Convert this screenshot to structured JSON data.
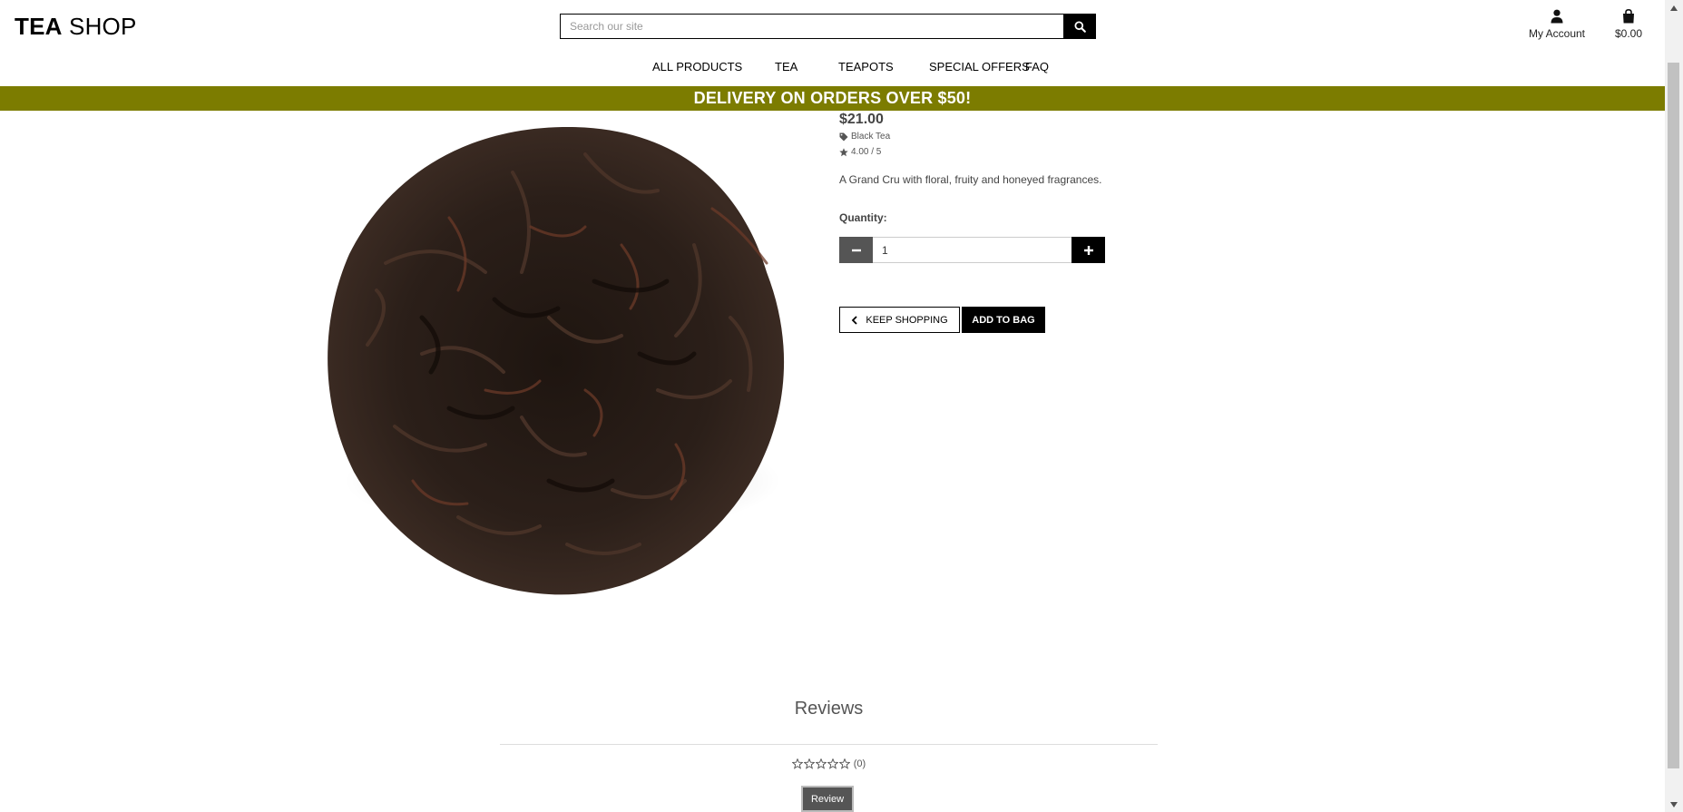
{
  "header": {
    "logo_bold": "TEA",
    "logo_light": " SHOP",
    "search_placeholder": "Search our site",
    "account_label": "My Account",
    "bag_total": "$0.00"
  },
  "nav": {
    "items": [
      "ALL PRODUCTS",
      "TEA",
      "TEAPOTS",
      "SPECIAL OFFERS",
      "FAQ"
    ]
  },
  "banner": {
    "text": "DELIVERY ON ORDERS OVER $50!"
  },
  "product": {
    "price": "$21.00",
    "category": "Black Tea",
    "rating": "4.00 / 5",
    "description": "A Grand Cru with floral, fruity and honeyed fragrances.",
    "quantity_label": "Quantity:",
    "quantity_value": "1",
    "keep_shopping_label": "KEEP SHOPPING",
    "add_to_bag_label": "ADD TO BAG"
  },
  "reviews": {
    "title": "Reviews",
    "count": "(0)",
    "review_button": "Review"
  },
  "colors": {
    "banner": "#7c7c00",
    "button_dark": "#000000",
    "button_grey": "#555555"
  },
  "icons": {
    "search": "search-icon",
    "account": "user-icon",
    "bag": "shopping-bag-icon",
    "tag": "tag-icon",
    "star": "star-icon",
    "minus": "minus-icon",
    "plus": "plus-icon",
    "chevron": "chevron-left-icon"
  }
}
